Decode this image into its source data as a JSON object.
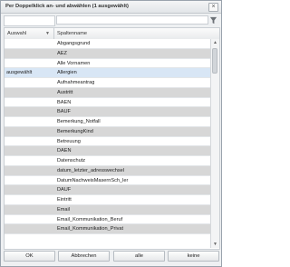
{
  "dialog": {
    "title": "Per Doppelklick an- und abwählen (1 ausgewählt)",
    "close_glyph": "×"
  },
  "filter": {
    "value": "",
    "placeholder": ""
  },
  "grid": {
    "columns": [
      {
        "label": "Auswahl",
        "sort_indicator": "▼"
      },
      {
        "label": "Spaltenname"
      }
    ],
    "rows": [
      {
        "auswahl": "",
        "spaltenname": "Abgangsgrund"
      },
      {
        "auswahl": "",
        "spaltenname": "AEZ"
      },
      {
        "auswahl": "",
        "spaltenname": "Alle Vornamen"
      },
      {
        "auswahl": "ausgewählt",
        "spaltenname": "Allergien",
        "selected": true
      },
      {
        "auswahl": "",
        "spaltenname": "Aufnahmeantrag"
      },
      {
        "auswahl": "",
        "spaltenname": "Austritt"
      },
      {
        "auswahl": "",
        "spaltenname": "BAEN"
      },
      {
        "auswahl": "",
        "spaltenname": "BAUF"
      },
      {
        "auswahl": "",
        "spaltenname": "Bemerkung_Notfall"
      },
      {
        "auswahl": "",
        "spaltenname": "BemerkungKind"
      },
      {
        "auswahl": "",
        "spaltenname": "Betreuung"
      },
      {
        "auswahl": "",
        "spaltenname": "DAEN"
      },
      {
        "auswahl": "",
        "spaltenname": "Datenschutz"
      },
      {
        "auswahl": "",
        "spaltenname": "datum_letzter_adresswechsel"
      },
      {
        "auswahl": "",
        "spaltenname": "DatumNachweisMasernSch_ler"
      },
      {
        "auswahl": "",
        "spaltenname": "DAUF"
      },
      {
        "auswahl": "",
        "spaltenname": "Eintritt"
      },
      {
        "auswahl": "",
        "spaltenname": "Email"
      },
      {
        "auswahl": "",
        "spaltenname": "Email_Kommunikation_Beruf"
      },
      {
        "auswahl": "",
        "spaltenname": "Email_Kommunikation_Privat"
      }
    ]
  },
  "scrollbar": {
    "up_glyph": "▲",
    "down_glyph": "▼"
  },
  "buttons": {
    "ok": "OK",
    "cancel": "Abbrechen",
    "all": "alle",
    "none": "keine"
  },
  "icons": {
    "filter": "filter-icon"
  },
  "colors": {
    "selected_row": "#d8e6f5",
    "alt_row": "#d7d7d7"
  }
}
